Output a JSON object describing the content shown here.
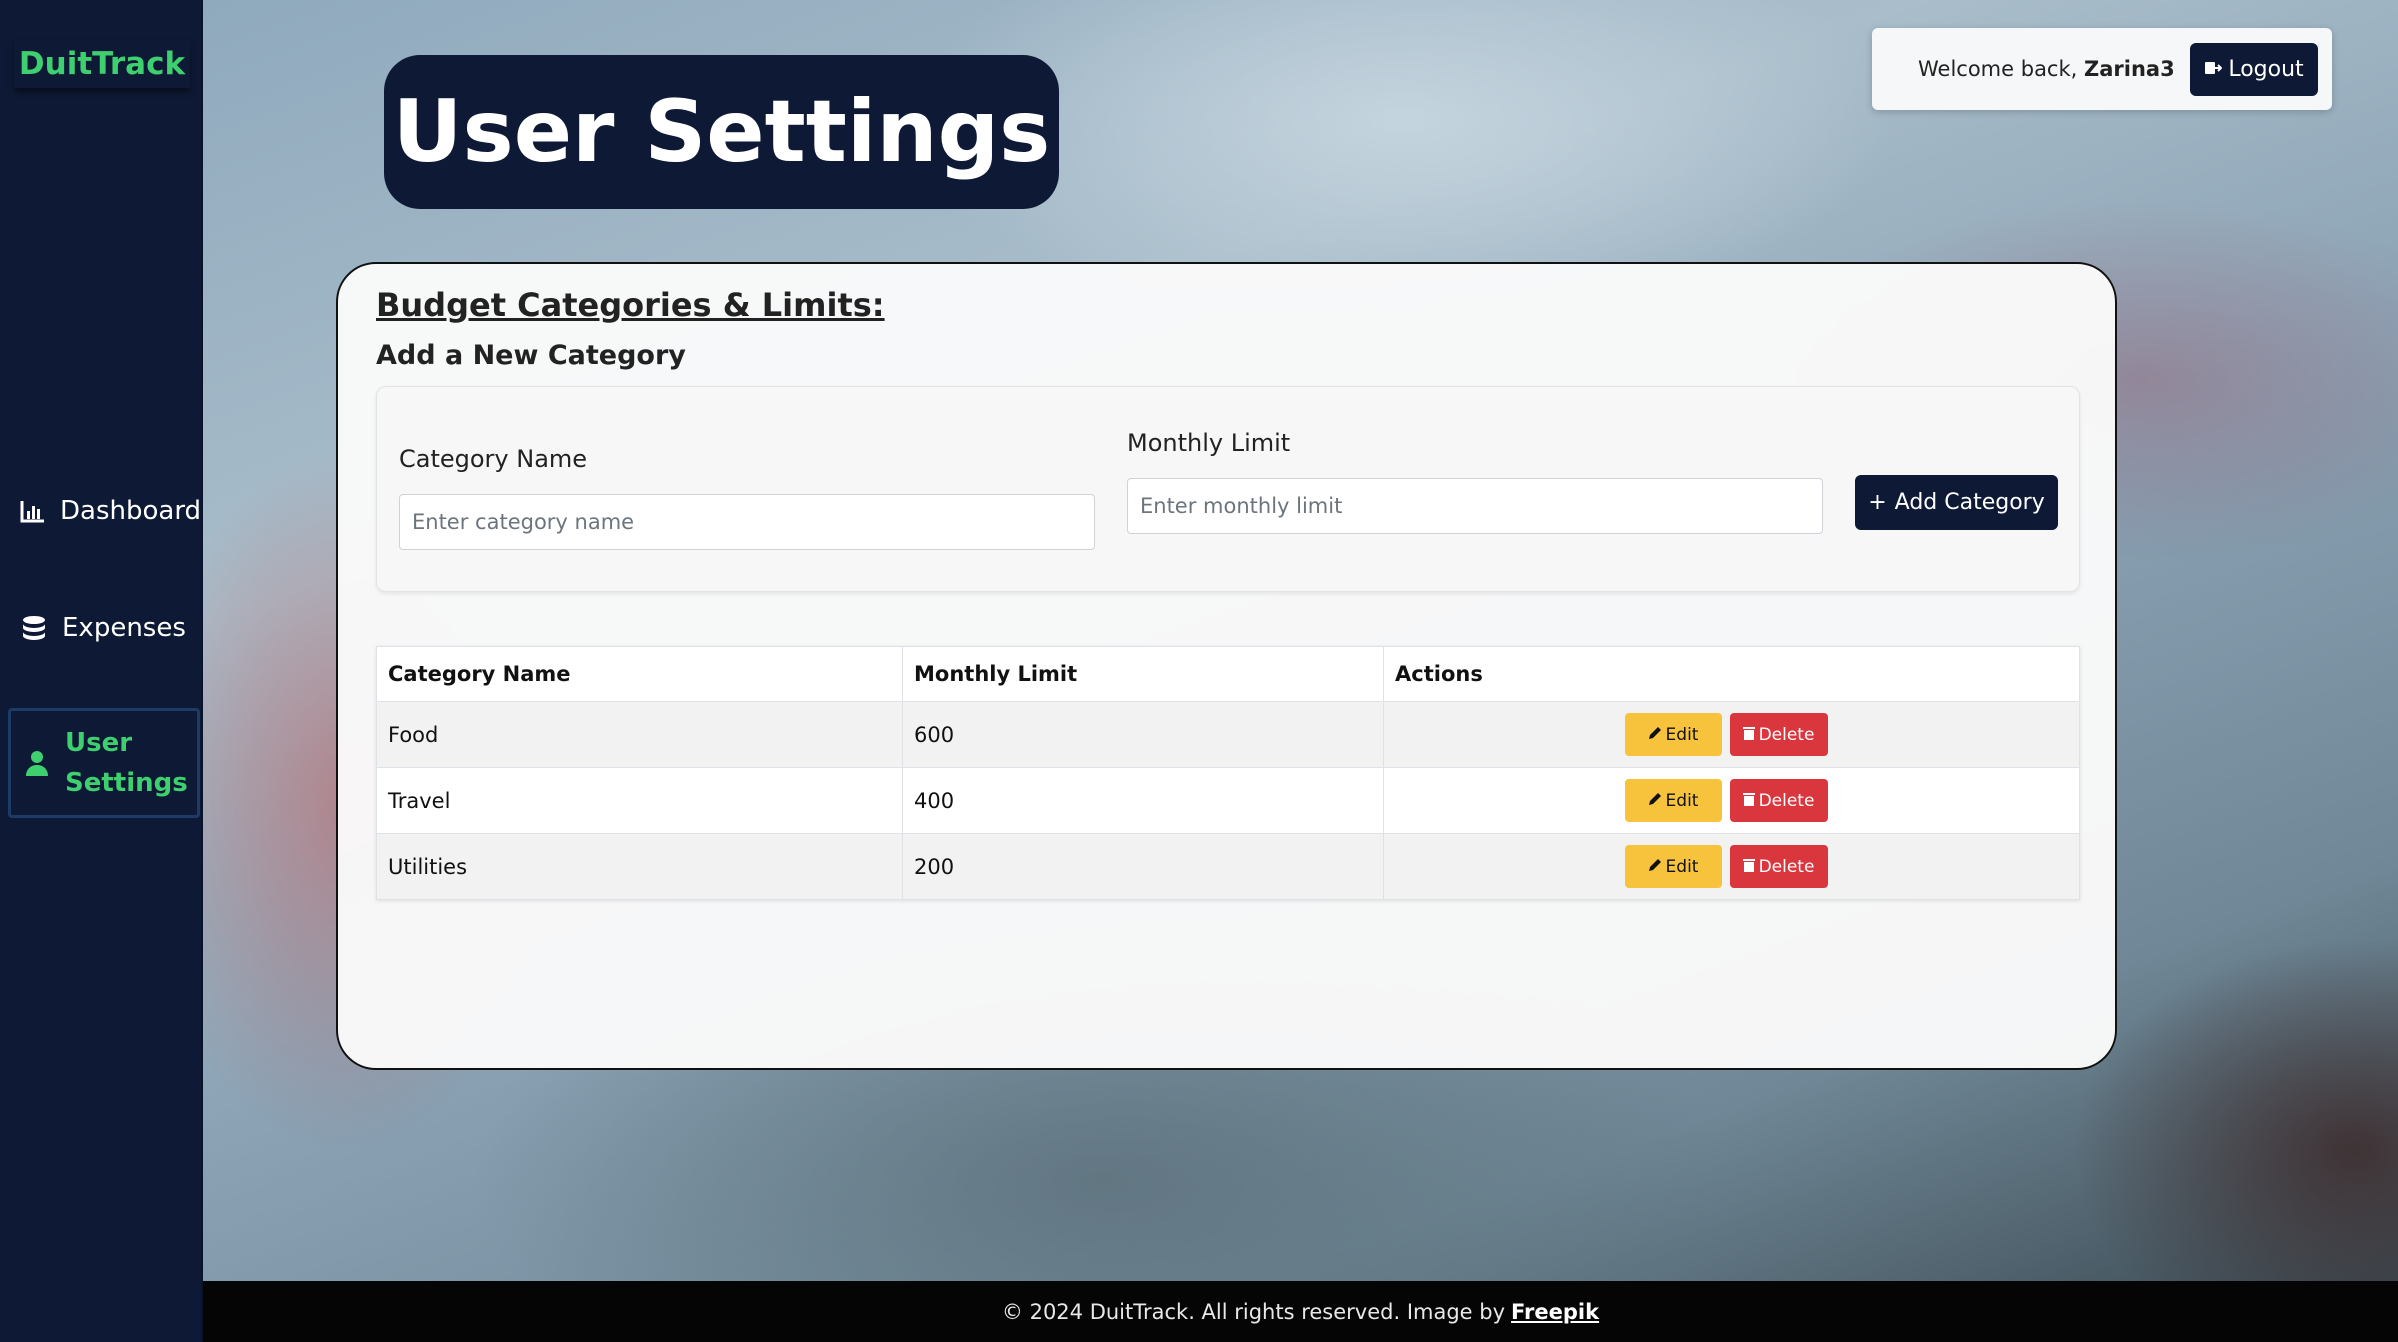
{
  "brand": "DuitTrack",
  "sidebar": {
    "items": [
      {
        "label": "Dashboard",
        "icon": "bar-chart-icon"
      },
      {
        "label": "Expenses",
        "icon": "coins-icon"
      },
      {
        "label": "User Settings",
        "icon": "user-icon",
        "active": true
      }
    ]
  },
  "page_title": "User Settings",
  "header": {
    "welcome_prefix": "Welcome back,",
    "username": "Zarina3",
    "logout_label": "Logout"
  },
  "settings": {
    "section_title": "Budget Categories & Limits:",
    "subtitle": "Add a New Category",
    "form": {
      "category_label": "Category Name",
      "category_placeholder": "Enter category name",
      "limit_label": "Monthly Limit",
      "limit_placeholder": "Enter monthly limit",
      "add_label": "Add Category"
    },
    "table": {
      "headers": [
        "Category Name",
        "Monthly Limit",
        "Actions"
      ],
      "rows": [
        {
          "name": "Food",
          "limit": "600"
        },
        {
          "name": "Travel",
          "limit": "400"
        },
        {
          "name": "Utilities",
          "limit": "200"
        }
      ],
      "edit_label": "Edit",
      "delete_label": "Delete"
    }
  },
  "footer": {
    "text": "© 2024 DuitTrack. All rights reserved. Image by",
    "link": "Freepik"
  },
  "colors": {
    "navy": "#0e1a35",
    "accent_green": "#3ecf6e",
    "edit_yellow": "#f7c33c",
    "delete_red": "#d9363e"
  }
}
